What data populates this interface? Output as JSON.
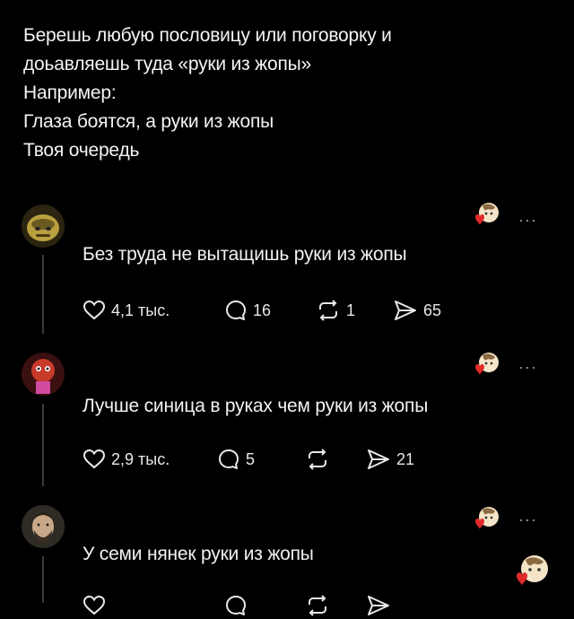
{
  "post": {
    "lines": [
      "Берешь любую пословицу или поговорку и",
      "доьавляешь туда «руки из жопы»",
      "Например:",
      "Глаза боятся, а руки из жопы",
      "Твоя очередь"
    ]
  },
  "replies": [
    {
      "text": "Без труда не вытащишь руки из жопы",
      "likes": "4,1 тыс.",
      "comments": "16",
      "reposts": "1",
      "shares": "65",
      "avatar_color": "#b8a040"
    },
    {
      "text": "Лучше синица в руках чем руки из жопы",
      "likes": "2,9 тыс.",
      "comments": "5",
      "reposts": "",
      "shares": "21",
      "avatar_color": "#c83a2a"
    },
    {
      "text": "У семи нянек руки из жопы",
      "likes": "",
      "comments": "",
      "reposts": "",
      "shares": "",
      "avatar_color": "#6a5a48"
    }
  ],
  "icons": {
    "like": "heart-icon",
    "comment": "comment-bubble-icon",
    "repost": "repost-icon",
    "share": "send-icon",
    "more": "more-dots-icon"
  },
  "more_label": "···",
  "colors": {
    "background": "#000000",
    "text": "#f2f2f2",
    "heart_badge": "#e02a2a"
  }
}
